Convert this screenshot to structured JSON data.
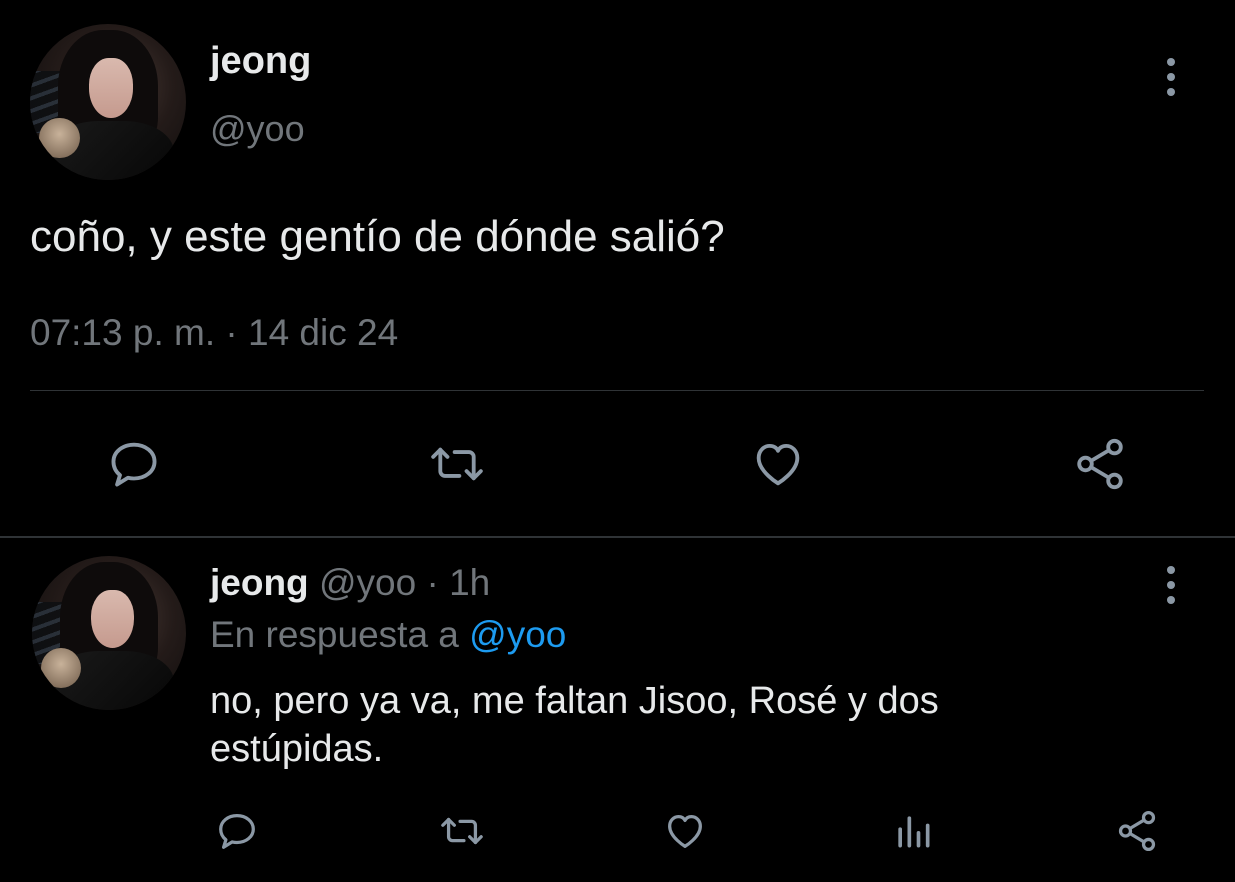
{
  "main_tweet": {
    "display_name": "jeong",
    "handle": "@yoo",
    "text": "coño, y este gentío de dónde salió?",
    "timestamp": "07:13 p. m. · 14 dic 24",
    "actions": [
      "reply-icon",
      "retweet-icon",
      "like-icon",
      "share-icon"
    ]
  },
  "reply_tweet": {
    "display_name": "jeong",
    "handle": "@yoo",
    "separator": "·",
    "time": "1h",
    "reply_prefix": "En respuesta a",
    "reply_mention": "@yoo",
    "text_line1": "no, pero ya va, me faltan Jisoo, Rosé y dos",
    "text_line2": "estúpidas.",
    "actions": [
      "reply-icon",
      "retweet-icon",
      "like-icon",
      "analytics-icon",
      "share-icon"
    ]
  },
  "colors": {
    "background": "#000000",
    "text": "#e7e9ea",
    "secondary": "#71767b",
    "icon": "#8b98a5",
    "accent": "#1d9bf0",
    "divider": "#2f3336"
  }
}
